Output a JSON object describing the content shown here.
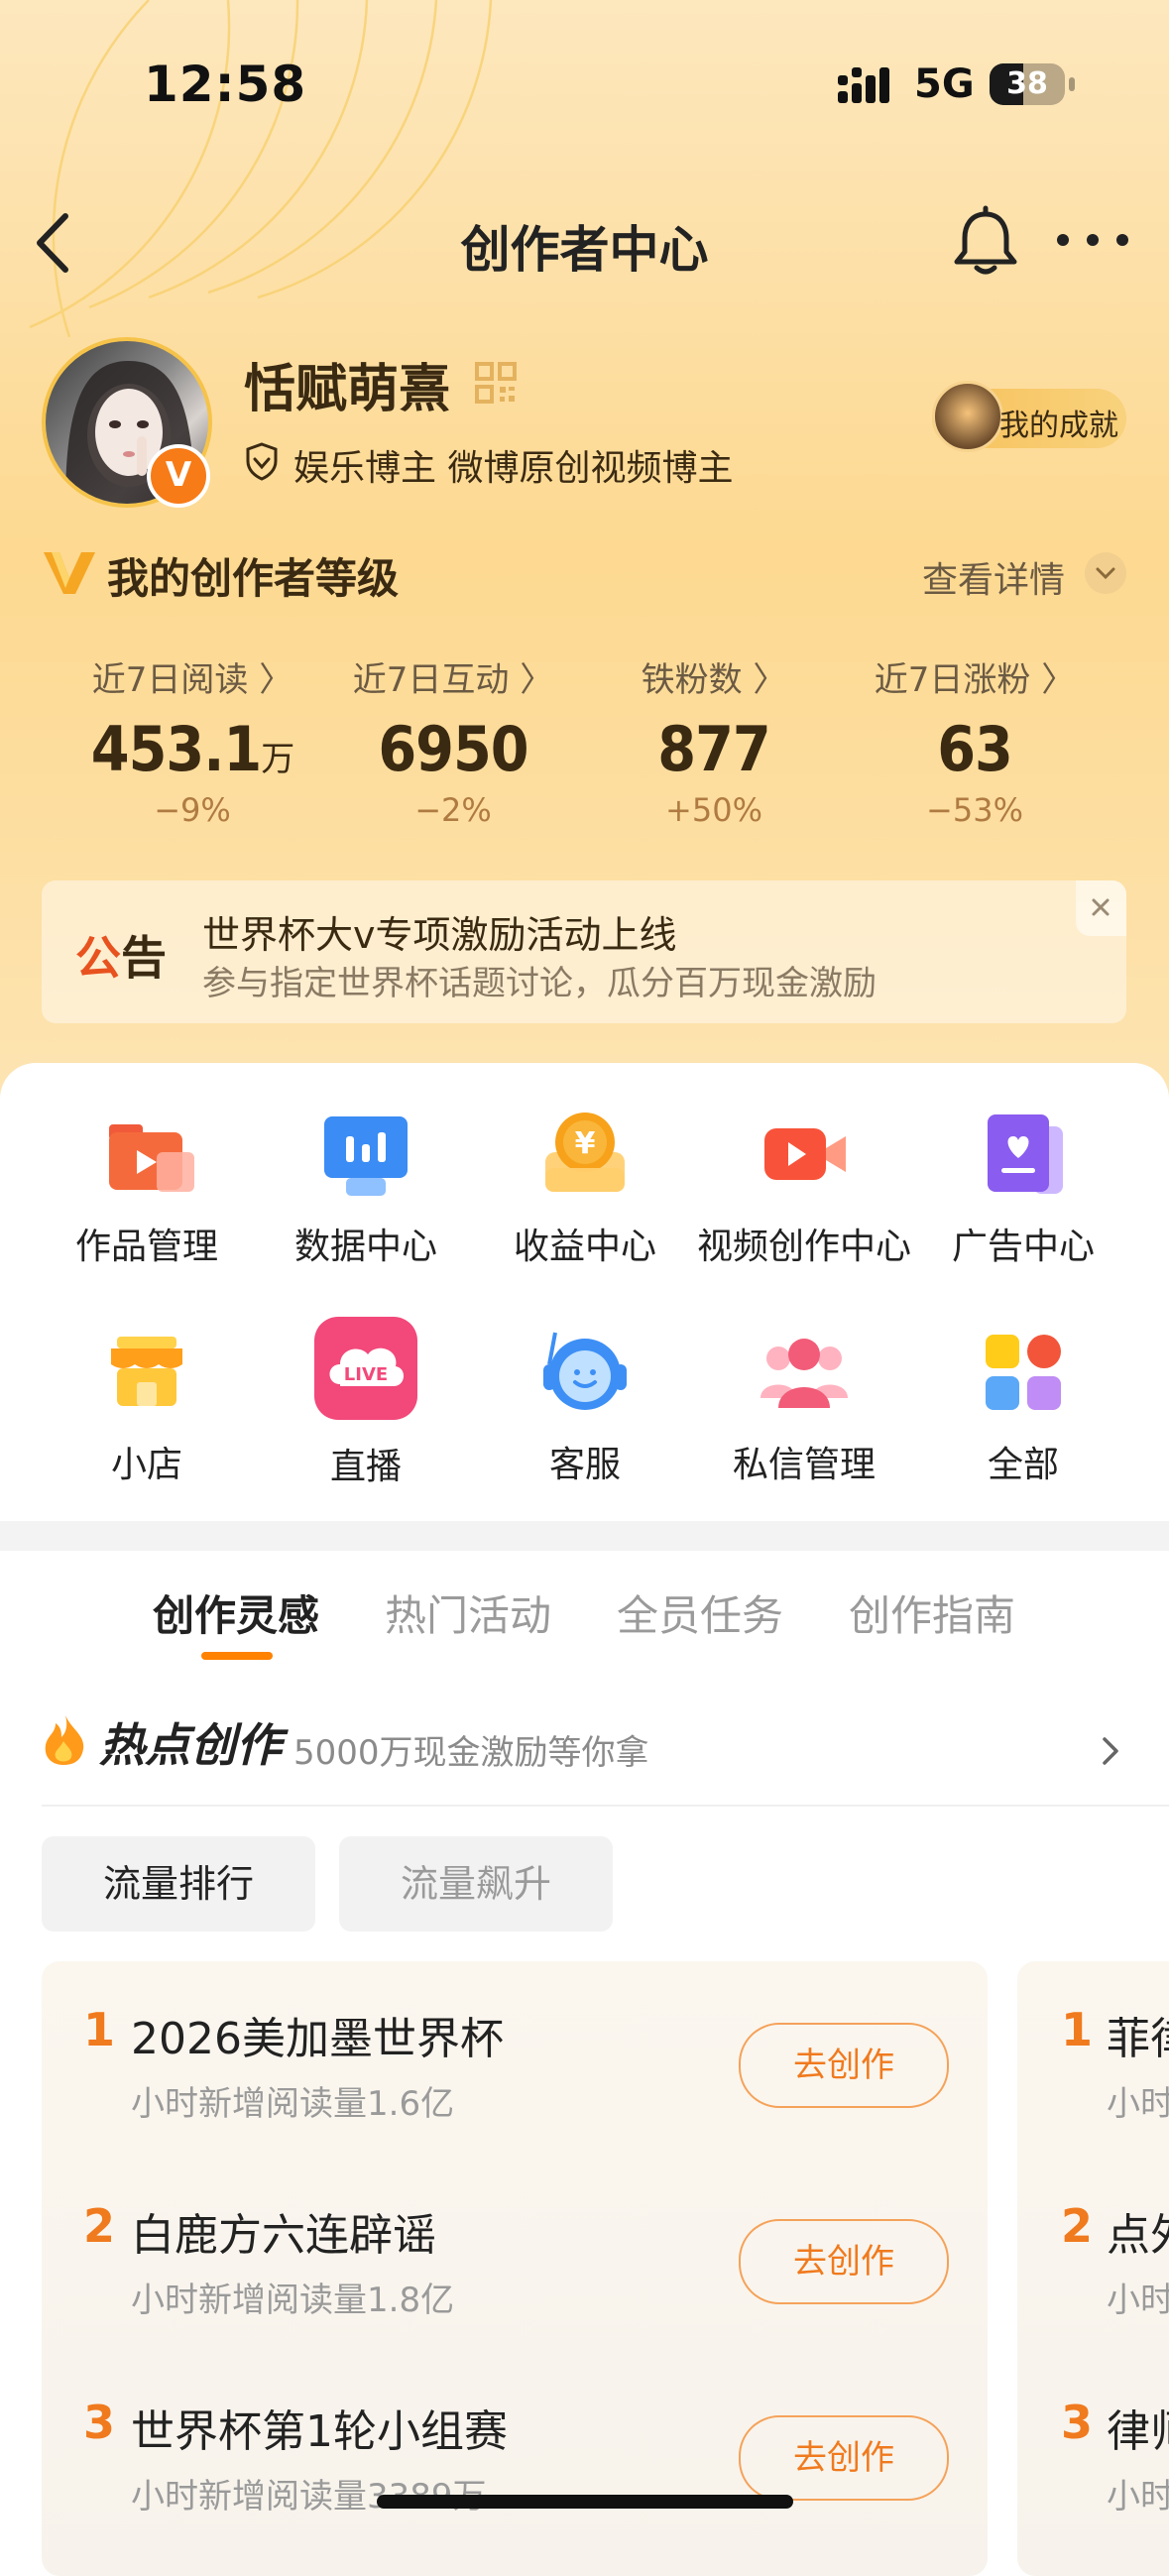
{
  "status_bar": {
    "time": "12:58",
    "network": "5G",
    "battery": "38"
  },
  "nav": {
    "title": "创作者中心"
  },
  "profile": {
    "name": "恬赋萌熹",
    "avatar_badge": "V",
    "description": "娱乐博主 微博原创视频博主",
    "achievement_label": "我的成就"
  },
  "level": {
    "title": "我的创作者等级",
    "detail_link": "查看详情"
  },
  "stats": [
    {
      "label": "近7日阅读 〉",
      "value": "453.1",
      "unit": "万",
      "change": "−9%"
    },
    {
      "label": "近7日互动 〉",
      "value": "6950",
      "unit": "",
      "change": "−2%"
    },
    {
      "label": "铁粉数 〉",
      "value": "877",
      "unit": "",
      "change": "+50%"
    },
    {
      "label": "近7日涨粉 〉",
      "value": "63",
      "unit": "",
      "change": "−53%"
    }
  ],
  "notice": {
    "tag_a": "公",
    "tag_b": "告",
    "title": "世界杯大v专项激励活动上线",
    "subtitle": "参与指定世界杯话题讨论，瓜分百万现金激励"
  },
  "tools": [
    {
      "label": "作品管理",
      "icon": "works-folder-icon"
    },
    {
      "label": "数据中心",
      "icon": "data-chart-icon"
    },
    {
      "label": "收益中心",
      "icon": "income-coin-icon"
    },
    {
      "label": "视频创作中心",
      "icon": "video-camera-icon"
    },
    {
      "label": "广告中心",
      "icon": "ad-heart-icon"
    },
    {
      "label": "小店",
      "icon": "shop-icon"
    },
    {
      "label": "直播",
      "icon": "live-icon"
    },
    {
      "label": "客服",
      "icon": "customer-service-icon"
    },
    {
      "label": "私信管理",
      "icon": "messages-people-icon"
    },
    {
      "label": "全部",
      "icon": "all-grid-icon"
    }
  ],
  "live_icon_text": "LIVE",
  "income_icon_text": "¥",
  "tabs": [
    "创作灵感",
    "热门活动",
    "全员任务",
    "创作指南"
  ],
  "hot": {
    "title": "热点创作",
    "subtitle": "5000万现金激励等你拿"
  },
  "filters": [
    "流量排行",
    "流量飙升"
  ],
  "rankings": [
    {
      "rank": "1",
      "title": "2026美加墨世界杯",
      "sub": "小时新增阅读量1.6亿",
      "button": "去创作"
    },
    {
      "rank": "2",
      "title": "白鹿方六连辟谣",
      "sub": "小时新增阅读量1.8亿",
      "button": "去创作"
    },
    {
      "rank": "3",
      "title": "世界杯第1轮小组赛",
      "sub": "小时新增阅读量3389万",
      "button": "去创作"
    }
  ],
  "rankings_next": [
    {
      "rank": "1",
      "title": "菲律",
      "sub": "小时"
    },
    {
      "rank": "2",
      "title": "点外",
      "sub": "小时"
    },
    {
      "rank": "3",
      "title": "律师",
      "sub": "小时"
    }
  ]
}
